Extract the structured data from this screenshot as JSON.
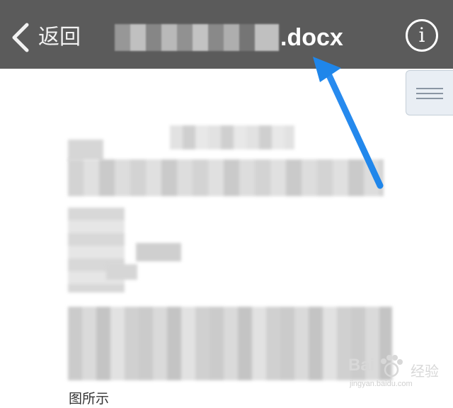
{
  "navbar": {
    "back_label": "返回",
    "title_extension": ".docx",
    "info_glyph": "i",
    "background": "#5b5b5b"
  },
  "document": {
    "caption": "图所示"
  },
  "watermark": {
    "brand": "Bai",
    "brand_suffix": "经验",
    "url": "jingyan.baidu.com"
  },
  "annotation": {
    "arrow_color": "#1e90ff"
  }
}
